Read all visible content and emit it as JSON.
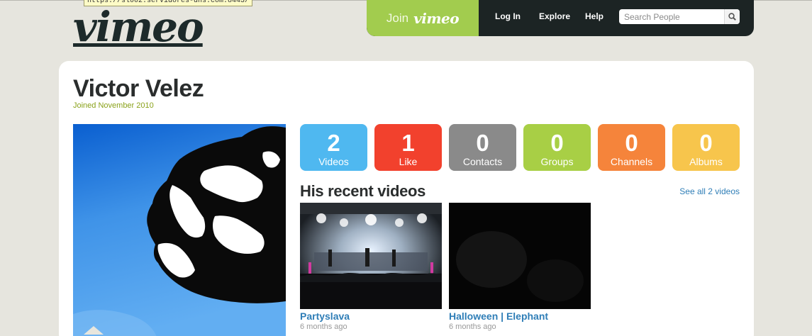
{
  "status_url": "https://sl002.servidores-dns.com:8443/",
  "logo": {
    "text": "vimeo"
  },
  "topnav": {
    "join_word": "Join",
    "join_logo": "vimeo",
    "login": "Log In",
    "explore": "Explore",
    "help": "Help",
    "search_placeholder": "Search People"
  },
  "profile": {
    "name": "Victor Velez",
    "joined": "Joined November 2010"
  },
  "stats": [
    {
      "count": "2",
      "label": "Videos",
      "color": "#4fb8f0"
    },
    {
      "count": "1",
      "label": "Like",
      "color": "#f2412d"
    },
    {
      "count": "0",
      "label": "Contacts",
      "color": "#8a8a8a"
    },
    {
      "count": "0",
      "label": "Groups",
      "color": "#a8cf45"
    },
    {
      "count": "0",
      "label": "Channels",
      "color": "#f5843b"
    },
    {
      "count": "0",
      "label": "Albums",
      "color": "#f7c54c"
    }
  ],
  "recent": {
    "title": "His recent videos",
    "see_all": "See all 2 videos",
    "videos": [
      {
        "title": "Partyslava",
        "age": "6 months ago"
      },
      {
        "title": "Halloween | Elephant",
        "age": "6 months ago"
      }
    ]
  }
}
